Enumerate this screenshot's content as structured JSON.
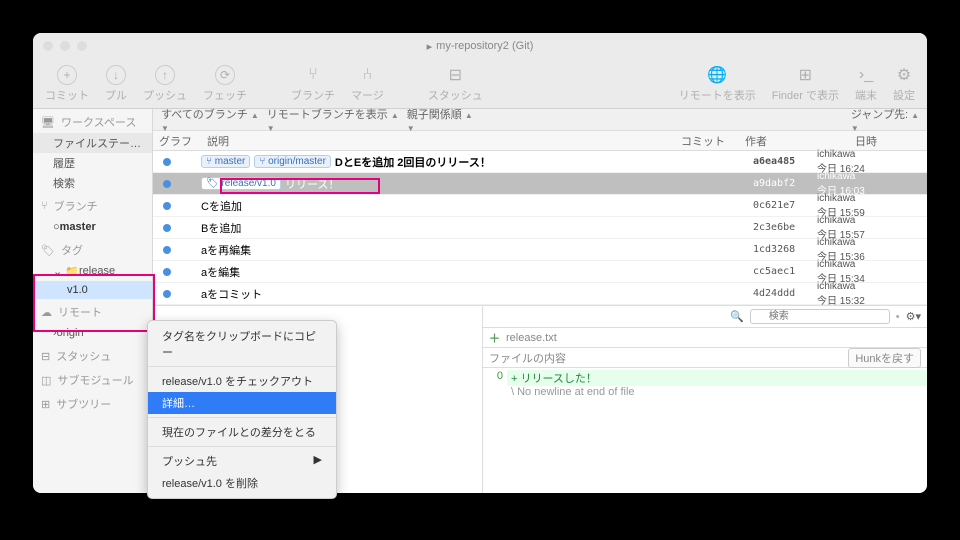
{
  "title": "my-repository2 (Git)",
  "toolbar": {
    "commit": "コミット",
    "pull": "プル",
    "push": "プッシュ",
    "fetch": "フェッチ",
    "branch": "ブランチ",
    "merge": "マージ",
    "stash": "スタッシュ",
    "remote": "リモートを表示",
    "finder": "Finder で表示",
    "terminal": "端末",
    "settings": "設定"
  },
  "sidebar": {
    "workspace": "ワークスペース",
    "filestatus": "ファイルステー…",
    "history": "履歴",
    "search": "検索",
    "branch_hdr": "ブランチ",
    "branch_master": "master",
    "tag_hdr": "タグ",
    "tag_folder": "release",
    "tag_v": "v1.0",
    "remote_hdr": "リモート",
    "remote_origin": "origin",
    "stash_hdr": "スタッシュ",
    "submodule_hdr": "サブモジュール",
    "subtree_hdr": "サブツリー"
  },
  "filter": {
    "all": "すべてのブランチ",
    "remote": "リモートブランチを表示",
    "order": "親子関係順",
    "jump": "ジャンプ先:"
  },
  "cols": {
    "graph": "グラフ",
    "desc": "説明",
    "commit": "コミット",
    "author": "作者",
    "date": "日時"
  },
  "commits": [
    {
      "badges": [
        "master",
        "origin/master"
      ],
      "msg": "DとEを追加 2回目のリリース！",
      "hash": "a6ea485",
      "author": "ichikawa <ichi…",
      "date": "今日 16:24",
      "sel": false,
      "branchIcon": true
    },
    {
      "badges": [
        "release/v1.0"
      ],
      "msg": "リリース！",
      "hash": "a9dabf2",
      "author": "ichikawa <ichika…",
      "date": "今日 16:03",
      "sel": true,
      "tagIcon": true
    },
    {
      "badges": [],
      "msg": "Cを追加",
      "hash": "0c621e7",
      "author": "ichikawa <ichika…",
      "date": "今日 15:59"
    },
    {
      "badges": [],
      "msg": "Bを追加",
      "hash": "2c3e6be",
      "author": "ichikawa <ichika…",
      "date": "今日 15:57"
    },
    {
      "badges": [],
      "msg": "aを再編集",
      "hash": "1cd3268",
      "author": "ichikawa <ichika…",
      "date": "今日 15:36"
    },
    {
      "badges": [],
      "msg": "aを編集",
      "hash": "cc5aec1",
      "author": "ichikawa <ichika…",
      "date": "今日 15:34"
    },
    {
      "badges": [],
      "msg": "aをコミット",
      "hash": "4d24ddd",
      "author": "ichikawa <ichika…",
      "date": "今日 15:32"
    }
  ],
  "menu": {
    "copy": "タグ名をクリップボードにコピー",
    "checkout": "release/v1.0 をチェックアウト",
    "details": "詳細…",
    "diff": "現在のファイルとの差分をとる",
    "push": "プッシュ先",
    "delete": "release/v1.0 を削除"
  },
  "detail": {
    "search_ph": "検索",
    "file": "release.txt",
    "hunk_label": "ファイルの内容",
    "hunk_btn": "Hunkを戻す",
    "line_add": "+ リリースした！",
    "line_meta": "\\ No newline at end of file",
    "line_num": "0"
  }
}
